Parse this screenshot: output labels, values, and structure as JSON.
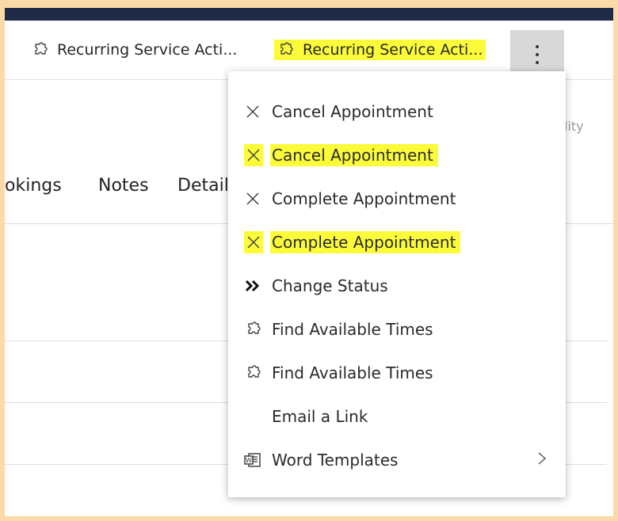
{
  "command_bar": {
    "tab1_label": "Recurring Service Acti...",
    "tab2_label": "Recurring Service Acti...",
    "more_label": "More commands"
  },
  "background": {
    "tabs": [
      "okings",
      "Notes",
      "Detail"
    ],
    "partial_right": "lity"
  },
  "menu": {
    "items": [
      {
        "label": "Cancel Appointment",
        "icon": "x-icon",
        "highlighted": false
      },
      {
        "label": "Cancel Appointment",
        "icon": "x-icon",
        "highlighted": true
      },
      {
        "label": "Complete Appointment",
        "icon": "x-icon",
        "highlighted": false
      },
      {
        "label": "Complete Appointment",
        "icon": "x-icon",
        "highlighted": true
      },
      {
        "label": "Change Status",
        "icon": "double-chevron-right-icon",
        "highlighted": false
      },
      {
        "label": "Find Available Times",
        "icon": "puzzle-icon",
        "highlighted": false
      },
      {
        "label": "Find Available Times",
        "icon": "puzzle-icon",
        "highlighted": false
      },
      {
        "label": "Email a Link",
        "icon": "",
        "highlighted": false
      },
      {
        "label": "Word Templates",
        "icon": "word-icon",
        "highlighted": false,
        "has_submenu": true
      }
    ]
  },
  "colors": {
    "highlight": "#fbfb3a",
    "topbar": "#1e2a47",
    "frame_border": "#fcd9a8"
  }
}
